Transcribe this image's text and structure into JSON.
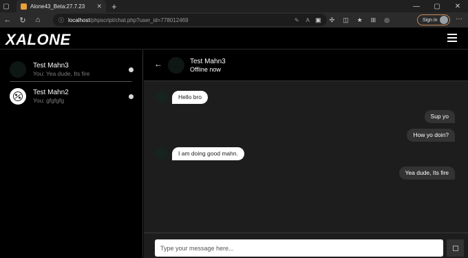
{
  "browser": {
    "tab_title": "Alone43_Beta:27.7.23",
    "url_scheme": "ⓘ",
    "url_host": "localhost",
    "url_path": "/phpscript/chat.php?user_id=778012469",
    "sign_in_label": "Sign in",
    "new_tab": "+",
    "close": "✕"
  },
  "app": {
    "logo": "XALONE"
  },
  "sidebar": {
    "contacts": [
      {
        "name": "Test Mahn3",
        "last_message": "You: Yea dude, Its fire"
      },
      {
        "name": "Test Mahn2",
        "last_message": "You: gfgfgfg"
      }
    ]
  },
  "chat": {
    "back_icon": "←",
    "contact_name": "Test Mahn3",
    "status": "Offline now",
    "messages": [
      {
        "direction": "incoming",
        "text": "Hello bro"
      },
      {
        "direction": "outgoing",
        "text": "Sup yo"
      },
      {
        "direction": "outgoing",
        "text": "How yo doin?"
      },
      {
        "direction": "incoming",
        "text": "I am doing good mahn."
      },
      {
        "direction": "outgoing",
        "text": "Yea dude, Its fire"
      }
    ],
    "input_placeholder": "Type your message here..."
  },
  "colors": {
    "background": "#000000",
    "chat_area": "#1d1d1d",
    "incoming_bubble": "#ffffff",
    "outgoing_bubble": "#333333",
    "accent_signin_border": "#c98a5a"
  },
  "icons": {
    "tab_favicon": "app-favicon-icon",
    "menu": "hamburger-menu-icon",
    "back": "back-arrow-icon",
    "send": "send-icon"
  }
}
